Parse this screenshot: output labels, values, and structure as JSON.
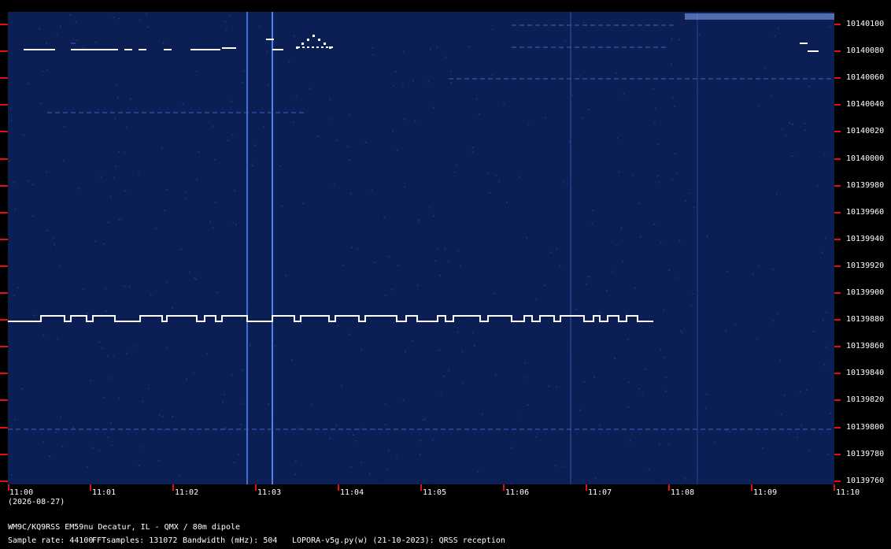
{
  "frequency_labels": [
    "10140100",
    "10140080",
    "10140060",
    "10140040",
    "10140020",
    "10140000",
    "10139980",
    "10139960",
    "10139940",
    "10139920",
    "10139900",
    "10139880",
    "10139860",
    "10139840",
    "10139820",
    "10139800",
    "10139780",
    "10139760"
  ],
  "time_labels": [
    "11:00",
    "11:01",
    "11:02",
    "11:03",
    "11:04",
    "11:05",
    "11:06",
    "11:07",
    "11:08",
    "11:09",
    "11:10"
  ],
  "date": "(2026-08-27)",
  "station": "WM9C/KQ9RSS EM59nu Decatur, IL - QMX / 80m dipole",
  "sample_rate": "Sample rate: 44100",
  "fft_samples": "FFTsamples: 131072",
  "bandwidth": "Bandwidth (mHz): 504",
  "software": "LOPORA-v5g.py(w) (21-10-2023): QRSS reception",
  "colors": {
    "background": "#0b1f55",
    "signal": "#ffffff",
    "tick": "#e01010"
  }
}
